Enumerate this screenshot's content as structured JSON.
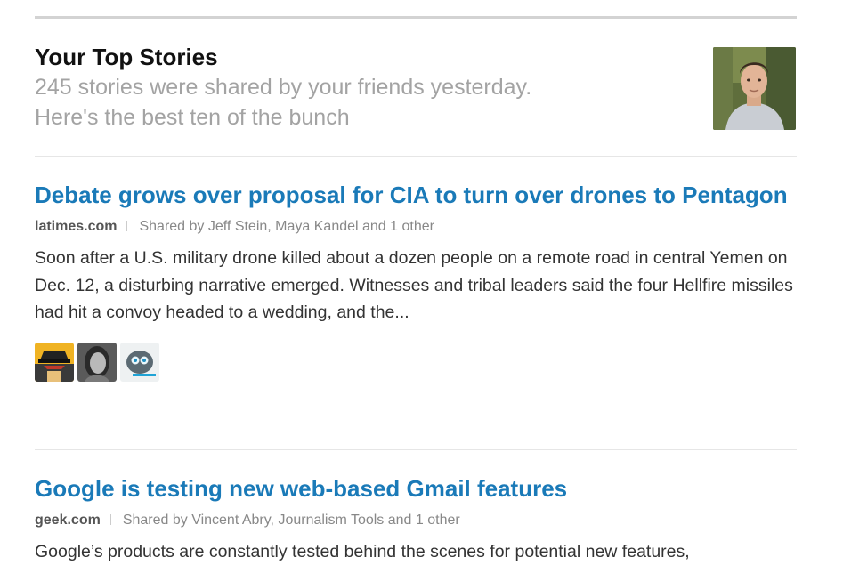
{
  "header": {
    "title": "Your Top Stories",
    "subtitle_line1": "245 stories were shared by your friends yesterday.",
    "subtitle_line2": "Here's the best ten of the bunch"
  },
  "stories": [
    {
      "title": "Debate grows over proposal for CIA to turn over drones to Pentagon",
      "source": "latimes.com",
      "shared_by": "Shared by Jeff Stein, Maya Kandel and 1 other",
      "excerpt": "Soon after a U.S. military drone killed about a dozen people on a remote road in central Yemen on Dec. 12, a disturbing narrative emerged. Witnesses and tribal leaders said the four Hellfire missiles had hit a convoy headed to a wedding, and the...",
      "friend_avatars": [
        "spy-avatar-icon",
        "woman-avatar-icon",
        "robot-avatar-icon"
      ]
    },
    {
      "title": "Google is testing new web-based Gmail features",
      "source": "geek.com",
      "shared_by": "Shared by Vincent Abry, Journalism Tools and 1 other",
      "excerpt": "Google’s products are constantly tested behind the scenes for potential new features,"
    }
  ],
  "colors": {
    "link": "#1a7ab8",
    "muted": "#a3a3a3",
    "divider": "#e6e6e6"
  }
}
